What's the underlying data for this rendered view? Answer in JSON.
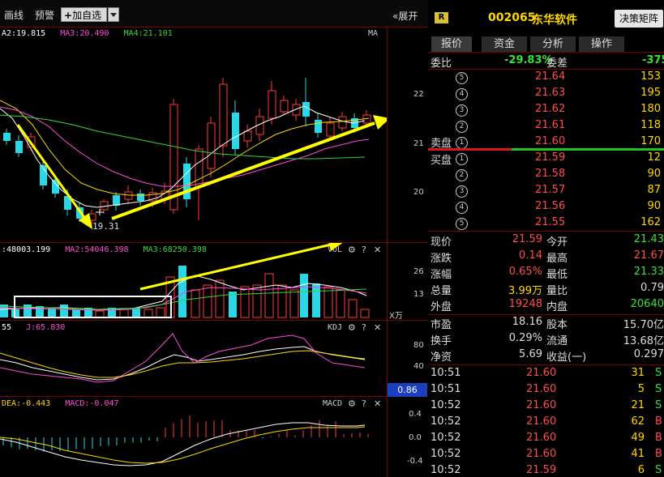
{
  "toolbar": {
    "draw_line": "画线",
    "alert": "预警",
    "add_favorite": "加自选",
    "expand": "展开"
  },
  "price_panel": {
    "legend": [
      {
        "text": "A2:19.815",
        "color": "#ffffff"
      },
      {
        "text": "MA3:20.490",
        "color": "#ff4bd8"
      },
      {
        "text": "MA4:21.101",
        "color": "#37d637"
      }
    ],
    "tag": "MA",
    "low_label": "19.31",
    "axis": [
      "22",
      "21",
      "20"
    ]
  },
  "vol_panel": {
    "legend": [
      {
        "text": ":48003.199",
        "color": "#ffffff"
      },
      {
        "text": "MA2:54046.398",
        "color": "#ff4bd8"
      },
      {
        "text": "MA3:68250.398",
        "color": "#37d637"
      }
    ],
    "tag": "VOL",
    "axis": [
      "26",
      "13"
    ],
    "unit": "X万"
  },
  "kdj_panel": {
    "legend": [
      {
        "text": "55",
        "color": "#ffffff"
      },
      {
        "text": "J:65.830",
        "color": "#ff4bd8"
      }
    ],
    "tag": "KDJ",
    "axis": [
      "80",
      "40"
    ],
    "badge": "0.86"
  },
  "macd_panel": {
    "legend": [
      {
        "text": "DEA:-0.443",
        "color": "#ffd800"
      },
      {
        "text": "MACD:-0.047",
        "color": "#ff4bd8"
      }
    ],
    "tag": "MACD",
    "axis": [
      "0.4",
      "0.0",
      "-0.4"
    ]
  },
  "stock": {
    "badge": "R",
    "code": "002065",
    "name": "东华软件",
    "decision_button": "决策矩阵"
  },
  "tabs": [
    "报价",
    "资金",
    "分析",
    "操作"
  ],
  "ratio": {
    "label1": "委比",
    "value1": "-29.83%",
    "label2": "委差",
    "value2": "-375"
  },
  "asks": [
    {
      "level": "5",
      "price": "21.64",
      "vol": "153"
    },
    {
      "level": "4",
      "price": "21.63",
      "vol": "195"
    },
    {
      "level": "3",
      "price": "21.62",
      "vol": "180"
    },
    {
      "level": "2",
      "price": "21.61",
      "vol": "118"
    },
    {
      "level": "1",
      "price": "21.60",
      "vol": "170"
    }
  ],
  "ask_label": "卖盘",
  "bid_label": "买盘",
  "bids": [
    {
      "level": "1",
      "price": "21.59",
      "vol": "12"
    },
    {
      "level": "2",
      "price": "21.58",
      "vol": "90"
    },
    {
      "level": "3",
      "price": "21.57",
      "vol": "87"
    },
    {
      "level": "4",
      "price": "21.56",
      "vol": "90"
    },
    {
      "level": "5",
      "price": "21.55",
      "vol": "162"
    }
  ],
  "quote": [
    {
      "l1": "现价",
      "v1": "21.59",
      "c1": "red",
      "l2": "今开",
      "v2": "21.43",
      "c2": "green"
    },
    {
      "l1": "涨跌",
      "v1": "0.14",
      "c1": "red",
      "l2": "最高",
      "v2": "21.67",
      "c2": "red"
    },
    {
      "l1": "涨幅",
      "v1": "0.65%",
      "c1": "red",
      "l2": "最低",
      "v2": "21.33",
      "c2": "green"
    },
    {
      "l1": "总量",
      "v1": "3.99万",
      "c1": "yellow",
      "l2": "量比",
      "v2": "0.79",
      "c2": "white"
    },
    {
      "l1": "外盘",
      "v1": "19248",
      "c1": "red",
      "l2": "内盘",
      "v2": "20640",
      "c2": "green"
    }
  ],
  "fund": [
    {
      "l1": "市盈",
      "v1": "18.16",
      "l2": "股本",
      "v2": "15.70亿"
    },
    {
      "l1": "换手",
      "v1": "0.29%",
      "l2": "流通",
      "v2": "13.68亿"
    },
    {
      "l1": "净资",
      "v1": "5.69",
      "l2": "收益(一)",
      "v2": "0.297"
    }
  ],
  "ticks": [
    {
      "time": "10:51",
      "price": "21.60",
      "vol": "31",
      "side": "S"
    },
    {
      "time": "10:51",
      "price": "21.60",
      "vol": "5",
      "side": "S"
    },
    {
      "time": "10:52",
      "price": "21.60",
      "vol": "21",
      "side": "S"
    },
    {
      "time": "10:52",
      "price": "21.60",
      "vol": "62",
      "side": "B"
    },
    {
      "time": "10:52",
      "price": "21.60",
      "vol": "49",
      "side": "B"
    },
    {
      "time": "10:52",
      "price": "21.60",
      "vol": "41",
      "side": "B"
    },
    {
      "time": "10:52",
      "price": "21.59",
      "vol": "6",
      "side": "S"
    }
  ],
  "colors": {
    "up": "#ff3b3b",
    "down": "#29d7e6",
    "ma_white": "#ffffff",
    "ma_yellow": "#ffd800",
    "ma_magenta": "#ff4bd8",
    "ma_green": "#37d637",
    "arrow": "#ffff00"
  }
}
